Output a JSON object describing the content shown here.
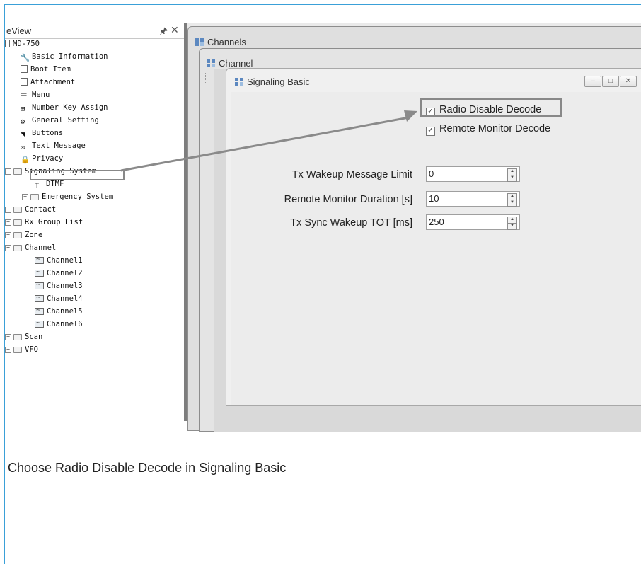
{
  "tree": {
    "header": "eView",
    "nodes": [
      {
        "label": "MD-750"
      },
      {
        "label": "Basic Information"
      },
      {
        "label": "Boot Item"
      },
      {
        "label": "Attachment"
      },
      {
        "label": "Menu"
      },
      {
        "label": "Number Key Assign"
      },
      {
        "label": "General Setting"
      },
      {
        "label": "Buttons"
      },
      {
        "label": "Text Message"
      },
      {
        "label": "Privacy"
      },
      {
        "label": "Signaling System"
      },
      {
        "label": "DTMF"
      },
      {
        "label": "Emergency System"
      },
      {
        "label": "Contact"
      },
      {
        "label": "Rx Group List"
      },
      {
        "label": "Zone"
      },
      {
        "label": "Channel"
      },
      {
        "label": "Channel1"
      },
      {
        "label": "Channel2"
      },
      {
        "label": "Channel3"
      },
      {
        "label": "Channel4"
      },
      {
        "label": "Channel5"
      },
      {
        "label": "Channel6"
      },
      {
        "label": "Scan"
      },
      {
        "label": "VFO"
      }
    ]
  },
  "windows": {
    "channels_title": "Channels",
    "channel_title": "Channel",
    "signaling_title": "Signaling Basic"
  },
  "signaling": {
    "radio_disable_decode": {
      "label": "Radio Disable Decode",
      "checked": true
    },
    "remote_monitor_decode": {
      "label": "Remote Monitor Decode",
      "checked": true
    },
    "fields": [
      {
        "label": "Tx Wakeup Message Limit",
        "value": "0"
      },
      {
        "label": "Remote Monitor Duration [s]",
        "value": "10"
      },
      {
        "label": "Tx Sync Wakeup TOT [ms]",
        "value": "250"
      }
    ]
  },
  "caption": "Choose Radio Disable Decode in Signaling Basic"
}
